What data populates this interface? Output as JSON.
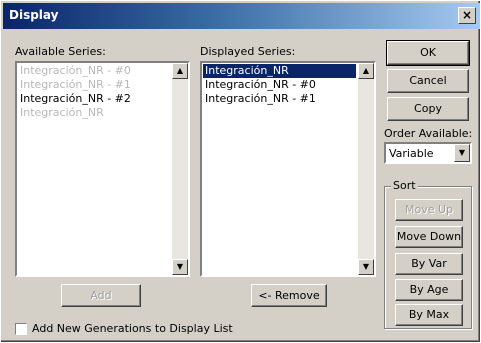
{
  "window": {
    "title": "Display",
    "close_glyph": "×"
  },
  "available_series": {
    "label": "Available Series:",
    "items": [
      {
        "label": "Integración_NR - #0",
        "state": "disabled"
      },
      {
        "label": "Integración_NR - #1",
        "state": "disabled"
      },
      {
        "label": "Integración_NR - #2",
        "state": "normal"
      },
      {
        "label": "Integración_NR",
        "state": "disabled"
      }
    ]
  },
  "displayed_series": {
    "label": "Displayed Series:",
    "items": [
      {
        "label": "Integración_NR",
        "state": "selected"
      },
      {
        "label": "Integración_NR - #0",
        "state": "normal"
      },
      {
        "label": "Integración_NR - #1",
        "state": "normal"
      }
    ]
  },
  "buttons": {
    "ok": "OK",
    "cancel": "Cancel",
    "copy": "Copy",
    "add": "Add",
    "remove": "<- Remove"
  },
  "order_available": {
    "label": "Order Available:",
    "value": "Variable"
  },
  "sort": {
    "label": "Sort",
    "move_up": "Move Up",
    "move_down": "Move Down",
    "by_var": "By Var",
    "by_age": "By Age",
    "by_max": "By Max"
  },
  "add_new_generations": {
    "label": "Add New Generations to Display List",
    "checked": false
  },
  "icons": {
    "scroll_up": "▲",
    "scroll_down": "▼",
    "dropdown": "▼"
  },
  "colors": {
    "selection": "#0a246a",
    "title_start": "#0a246a",
    "title_end": "#a6caf0"
  }
}
